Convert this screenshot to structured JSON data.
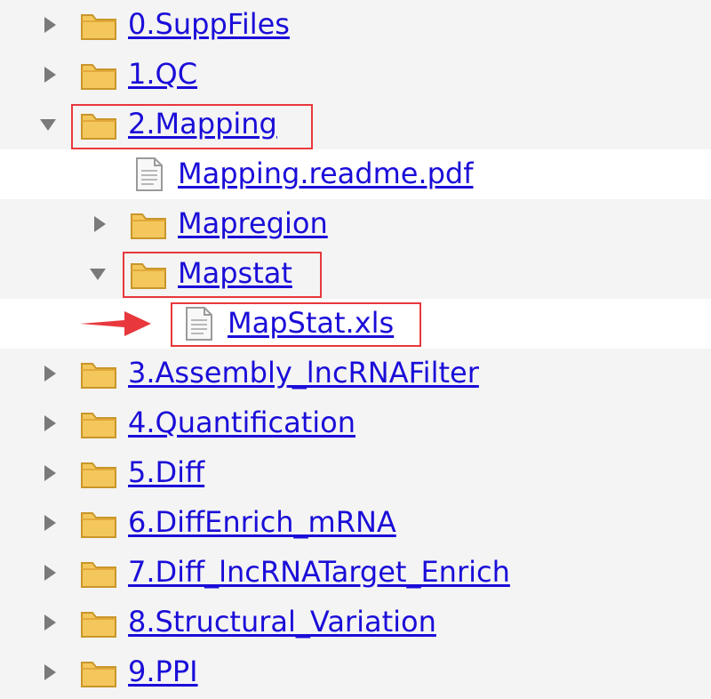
{
  "tree": {
    "items": [
      {
        "label": "0.SuppFiles",
        "type": "folder",
        "expanded": false,
        "depth": 0
      },
      {
        "label": "1.QC",
        "type": "folder",
        "expanded": false,
        "depth": 0
      },
      {
        "label": "2.Mapping",
        "type": "folder",
        "expanded": true,
        "depth": 0,
        "highlighted": true
      },
      {
        "label": "Mapping.readme.pdf",
        "type": "file",
        "depth": 1
      },
      {
        "label": "Mapregion",
        "type": "folder",
        "expanded": false,
        "depth": 1
      },
      {
        "label": "Mapstat",
        "type": "folder",
        "expanded": true,
        "depth": 1,
        "highlighted": true
      },
      {
        "label": "MapStat.xls",
        "type": "file",
        "depth": 2,
        "highlighted": true,
        "pointed_by_arrow": true
      },
      {
        "label": "3.Assembly_lncRNAFilter",
        "type": "folder",
        "expanded": false,
        "depth": 0
      },
      {
        "label": "4.Quantification",
        "type": "folder",
        "expanded": false,
        "depth": 0
      },
      {
        "label": "5.Diff",
        "type": "folder",
        "expanded": false,
        "depth": 0
      },
      {
        "label": "6.DiffEnrich_mRNA",
        "type": "folder",
        "expanded": false,
        "depth": 0
      },
      {
        "label": "7.Diff_lncRNATarget_Enrich",
        "type": "folder",
        "expanded": false,
        "depth": 0
      },
      {
        "label": "8.Structural_Variation",
        "type": "folder",
        "expanded": false,
        "depth": 0
      },
      {
        "label": "9.PPI",
        "type": "folder",
        "expanded": false,
        "depth": 0
      }
    ]
  },
  "colors": {
    "link": "#1a0dd8",
    "highlight_box": "#e8383d",
    "arrow": "#e8383d",
    "folder": "#f3c75b",
    "background": "#f4f4f4"
  }
}
